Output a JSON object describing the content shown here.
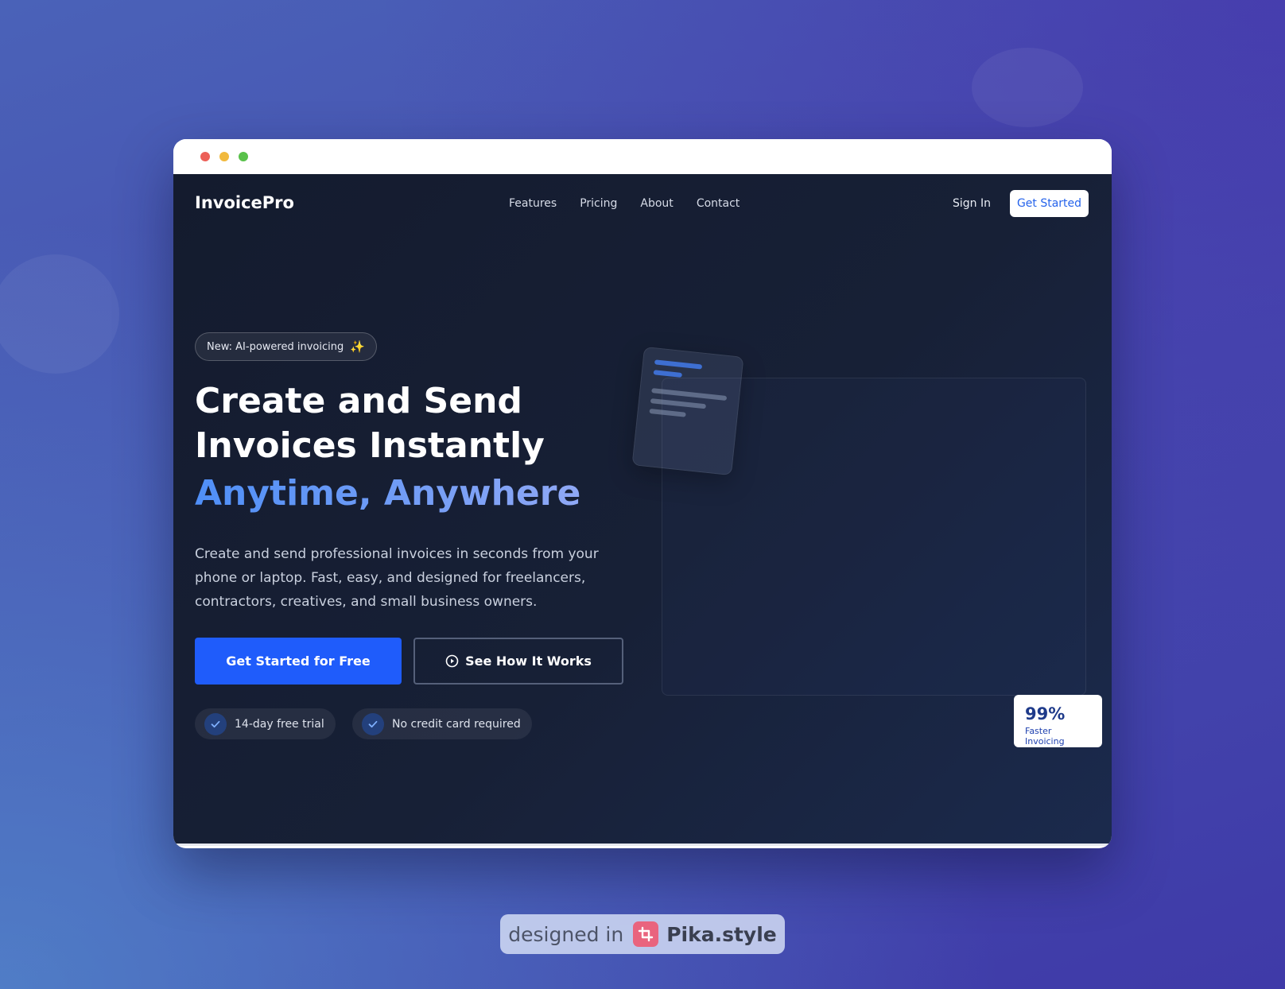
{
  "nav": {
    "logo": "InvoicePro",
    "links": [
      "Features",
      "Pricing",
      "About",
      "Contact"
    ],
    "sign_in": "Sign In",
    "cta": "Get Started"
  },
  "hero": {
    "badge_text": "New: AI-powered invoicing",
    "badge_emoji": "✨",
    "title_line1": "Create and Send",
    "title_line2": "Invoices Instantly",
    "title_accent": "Anytime, Anywhere",
    "subtitle": "Create and send professional invoices in seconds from your phone or laptop. Fast, easy, and designed for freelancers, contractors, creatives, and small business owners.",
    "primary_button": "Get Started for Free",
    "secondary_button": "See How It Works",
    "features": [
      "14-day free trial",
      "No credit card required"
    ]
  },
  "stat": {
    "value": "99%",
    "label": "Faster Invoicing"
  },
  "watermark": {
    "prefix": "designed in",
    "brand": "Pika.style"
  },
  "icons": [
    "sparkles-icon",
    "play-circle-icon",
    "check-icon",
    "document-icon",
    "pika-logo-icon"
  ],
  "colors": {
    "primary": "#1f5cfb",
    "accent_gradient_start": "#4f8ff7",
    "accent_gradient_end": "#8fa8f5",
    "app_background": "#141b2e",
    "stat_text": "#1e3a8a"
  }
}
